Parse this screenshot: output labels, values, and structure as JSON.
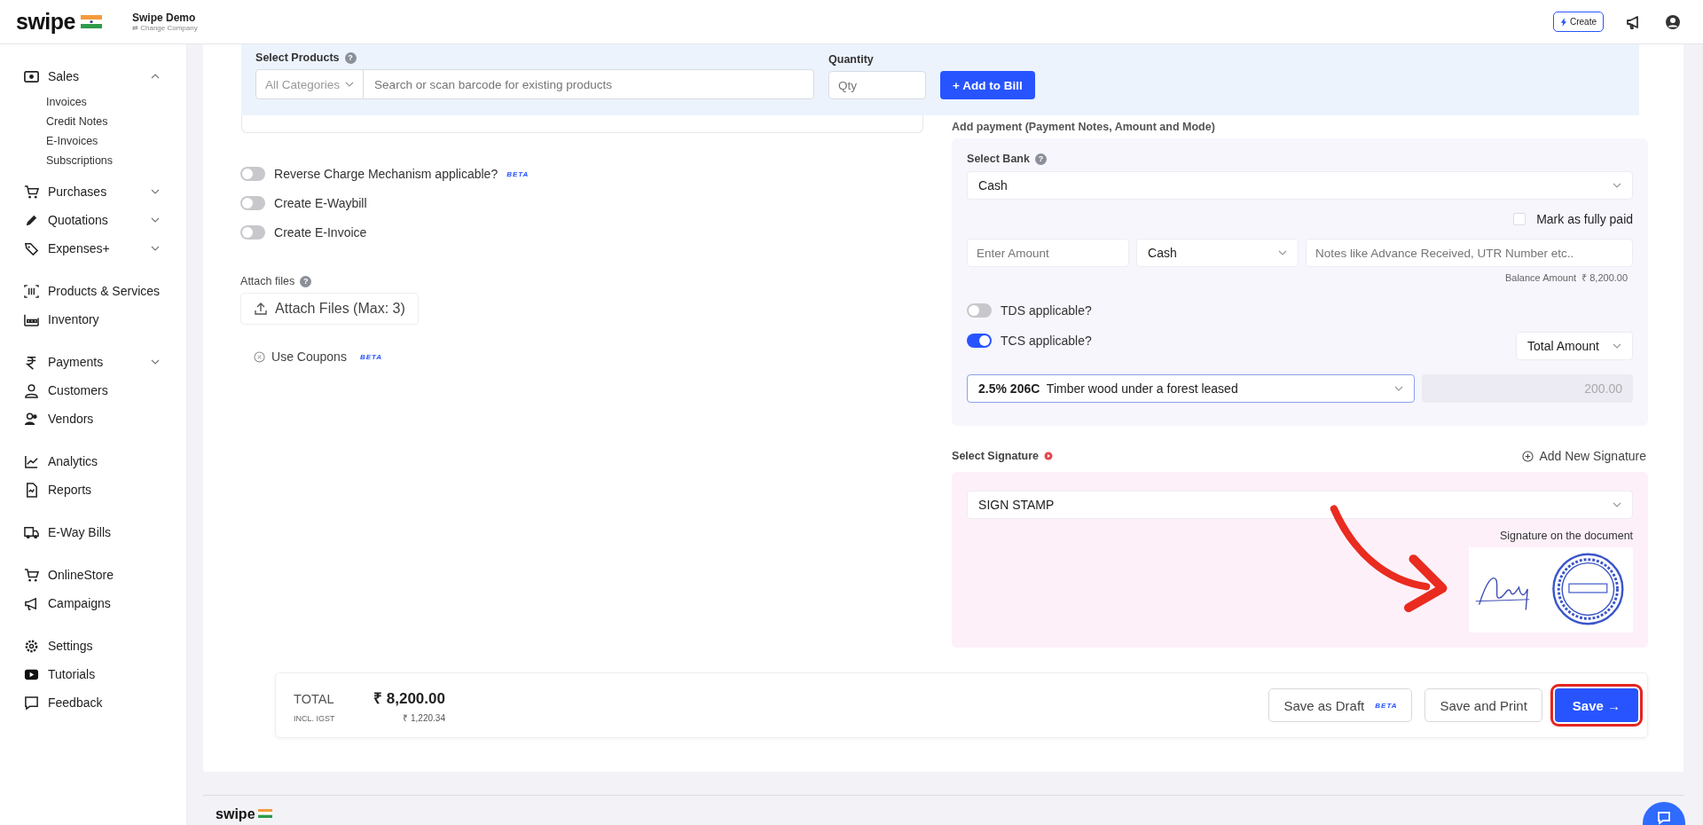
{
  "topbar": {
    "logo": "swipe",
    "company": "Swipe Demo",
    "change_company": "⇄ Change Company",
    "create_button": "Create"
  },
  "sidebar": {
    "groups": [
      [
        {
          "label": "Sales",
          "expanded": true,
          "children": [
            {
              "label": "Invoices"
            },
            {
              "label": "Credit Notes"
            },
            {
              "label": "E-Invoices"
            },
            {
              "label": "Subscriptions"
            }
          ]
        },
        {
          "label": "Purchases",
          "expanded": false
        },
        {
          "label": "Quotations",
          "expanded": false
        },
        {
          "label": "Expenses+",
          "expanded": false
        }
      ],
      [
        {
          "label": "Products & Services"
        },
        {
          "label": "Inventory"
        }
      ],
      [
        {
          "label": "Payments",
          "expanded": false
        },
        {
          "label": "Customers"
        },
        {
          "label": "Vendors"
        }
      ],
      [
        {
          "label": "Analytics"
        },
        {
          "label": "Reports"
        }
      ],
      [
        {
          "label": "E-Way Bills"
        }
      ],
      [
        {
          "label": "OnlineStore"
        },
        {
          "label": "Campaigns"
        }
      ],
      [
        {
          "label": "Settings"
        },
        {
          "label": "Tutorials"
        },
        {
          "label": "Feedback"
        }
      ]
    ]
  },
  "product_bar": {
    "label": "Select Products",
    "help": "?",
    "category": "All Categories",
    "search_placeholder": "Search or scan barcode for existing products",
    "quantity_label": "Quantity",
    "qty_placeholder": "Qty",
    "add_button": "+ Add to Bill"
  },
  "options": [
    {
      "label": "Reverse Charge Mechanism applicable?",
      "on": false,
      "badge": "BETA"
    },
    {
      "label": "Create E-Waybill",
      "on": false
    },
    {
      "label": "Create E-Invoice",
      "on": false
    }
  ],
  "attach": {
    "label": "Attach files",
    "help": "?",
    "button": "Attach Files (Max: 3)"
  },
  "coupons": {
    "label": "Use Coupons",
    "badge": "BETA"
  },
  "payment": {
    "title": "Add payment (Payment Notes, Amount and Mode)",
    "bank_label": "Select Bank",
    "bank_help": "?",
    "bank": "Cash",
    "mark_paid": {
      "label": "Mark as fully paid",
      "checked": false
    },
    "amount_placeholder": "Enter Amount",
    "mode": "Cash",
    "notes_placeholder": "Notes like Advance Received, UTR Number etc..",
    "balance": "Balance Amount  ₹ 8,200.00",
    "tds": {
      "label": "TDS applicable?",
      "on": false
    },
    "tcs": {
      "label": "TCS applicable?",
      "on": true
    },
    "tcs_base": "Total Amount",
    "tcs_rate": "2.5% 206C",
    "tcs_desc": "Timber wood under a forest leased",
    "tcs_amount": "200.00"
  },
  "signature": {
    "label": "Select Signature",
    "add": "Add New Signature",
    "selected": "SIGN STAMP",
    "preview_label": "Signature on the document"
  },
  "totals": {
    "label": "TOTAL",
    "amount": "₹ 8,200.00",
    "tax_label": "INCL. IGST",
    "tax": "₹ 1,220.34"
  },
  "actions": [
    {
      "label": "Save as Draft",
      "kind": "outline",
      "badge": "BETA",
      "highlighted": false
    },
    {
      "label": "Save and Print",
      "kind": "outline",
      "highlighted": false
    },
    {
      "label": "Save →",
      "kind": "primary",
      "highlighted": true
    }
  ],
  "footer": {
    "logo": "swipe"
  }
}
